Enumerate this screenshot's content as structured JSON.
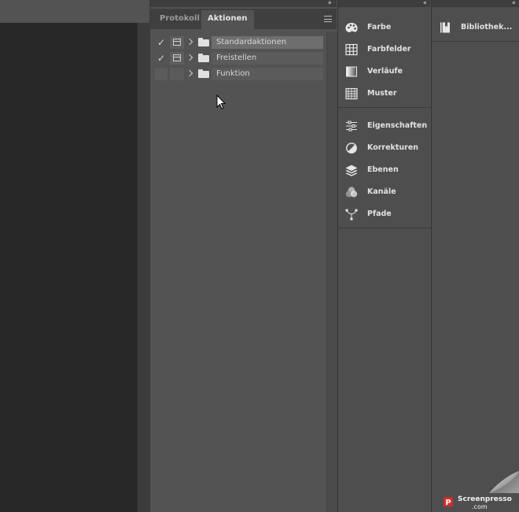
{
  "panel_tabs": [
    {
      "label": "Protokoll",
      "active": false
    },
    {
      "label": "Aktionen",
      "active": true
    }
  ],
  "actions": [
    {
      "name": "Standardaktionen",
      "checked": true,
      "dialog": true,
      "selected": true
    },
    {
      "name": "Freistellen",
      "checked": true,
      "dialog": true,
      "selected": false
    },
    {
      "name": "Funktion",
      "checked": false,
      "dialog": false,
      "selected": false
    }
  ],
  "dock": {
    "group1": [
      {
        "label": "Farbe",
        "icon": "color-palette-icon"
      },
      {
        "label": "Farbfelder",
        "icon": "swatches-grid-icon"
      },
      {
        "label": "Verläufe",
        "icon": "gradient-icon"
      },
      {
        "label": "Muster",
        "icon": "pattern-icon"
      }
    ],
    "group2": [
      {
        "label": "Eigenschaften",
        "icon": "properties-sliders-icon"
      },
      {
        "label": "Korrekturen",
        "icon": "adjustments-icon"
      },
      {
        "label": "Ebenen",
        "icon": "layers-icon"
      },
      {
        "label": "Kanäle",
        "icon": "channels-icon"
      },
      {
        "label": "Pfade",
        "icon": "paths-icon"
      }
    ]
  },
  "library": {
    "label": "Bibliothek...",
    "icon": "library-book-icon"
  },
  "watermark": {
    "brand": "Screenpresso",
    "domain": ".com"
  },
  "colors": {
    "background": "#535353",
    "canvas": "#282828",
    "selected_row": "#6e6e6e"
  }
}
